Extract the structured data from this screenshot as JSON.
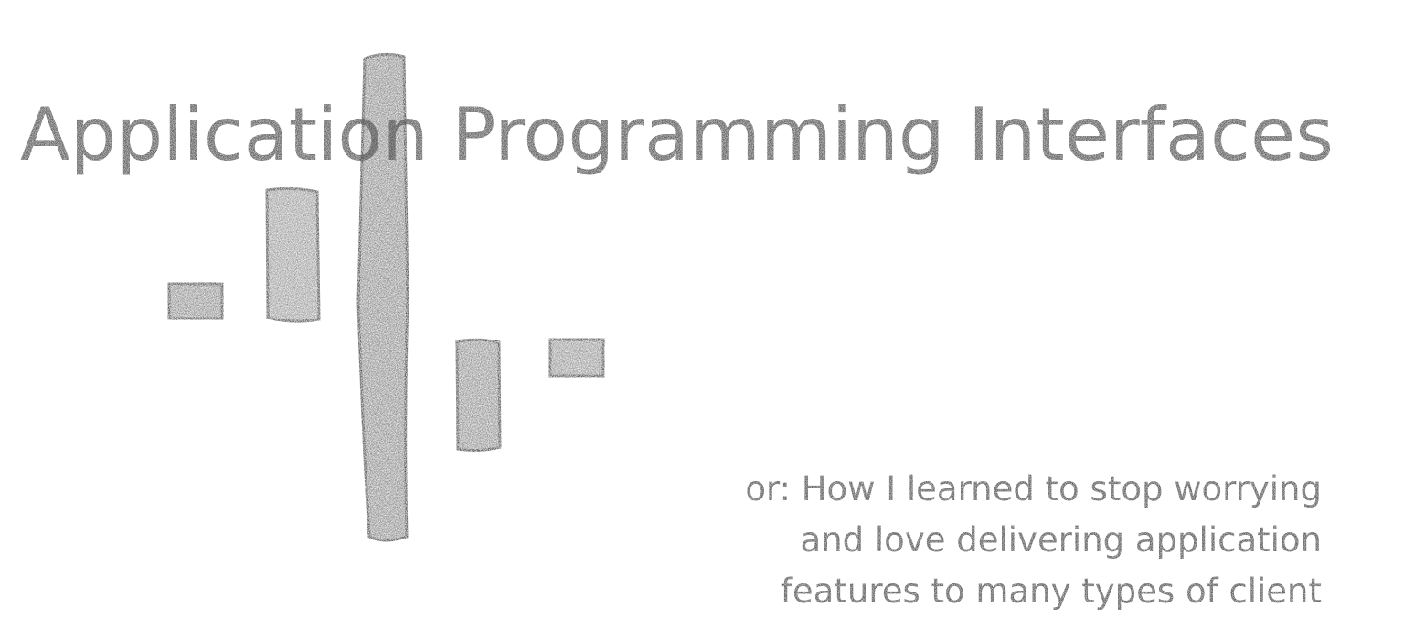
{
  "slide": {
    "title": "Application Programming Interfaces",
    "subtitle_lines": [
      "or: How I learned to stop worrying",
      "and love delivering application",
      "features to many types of client"
    ]
  },
  "colors": {
    "background": "#ffffff",
    "pencil_fill": "#8a8a8a",
    "pencil_outline": "#3c3c3c",
    "text": "#555555"
  }
}
